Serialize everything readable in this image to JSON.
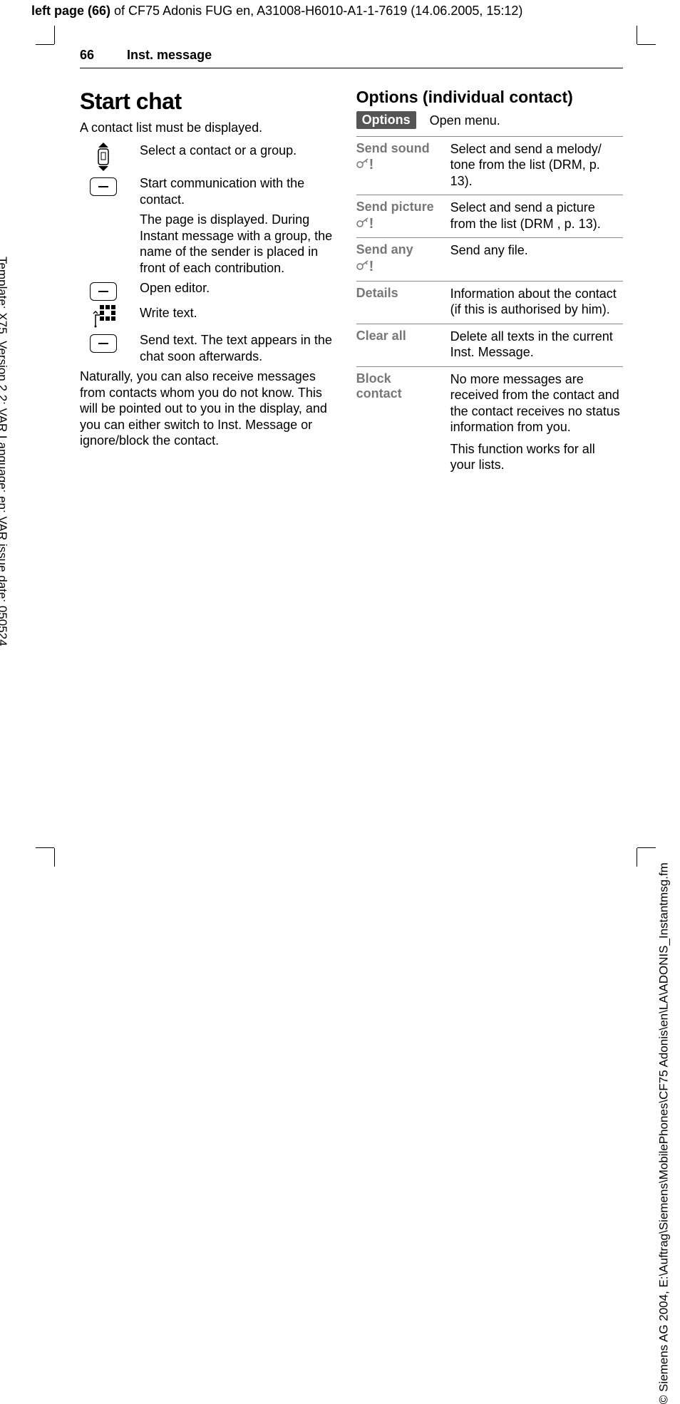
{
  "header": {
    "left_label": "left page (66)",
    "of": " of CF75 Adonis FUG en, A31008-H6010-A1-1-7619 (14.06.2005, 15:12)"
  },
  "side_left": "Template: X75, Version 2.2; VAR Language: en; VAR issue date: 050524",
  "side_right": "© Siemens AG 2004, E:\\Auftrag\\Siemens\\MobilePhones\\CF75 Adonis\\en\\LA\\ADONIS_Instantmsg.fm",
  "runhead": {
    "page": "66",
    "section": "Inst. message"
  },
  "left": {
    "title": "Start chat",
    "intro": "A contact list must be displayed.",
    "steps": [
      {
        "icon": "scroll-icon",
        "text": "Select a contact or a group."
      },
      {
        "icon": "softkey-icon",
        "text": "Start communication with the contact."
      },
      {
        "icon": "",
        "text": "The page is displayed. During Instant message with a group, the name of the sender is placed in front of each contribution."
      },
      {
        "icon": "softkey-icon",
        "text": "Open editor."
      },
      {
        "icon": "keypad-icon",
        "text": "Write text."
      },
      {
        "icon": "softkey-icon",
        "text": "Send text. The text appears in the chat soon afterwards."
      }
    ],
    "footer": "Naturally, you can also receive messages from contacts whom you do not know. This will be pointed out to you in the display, and you can either switch to Inst. Message or ignore/block the contact."
  },
  "right": {
    "heading": "Options (individual contact)",
    "options_label": "Options",
    "open_menu": "Open menu.",
    "rows": [
      {
        "name": "Send sound",
        "drm": true,
        "drm_below": true,
        "desc": "Select and send a melody/ tone from the list (DRM, p. 13)."
      },
      {
        "name": "Send picture",
        "drm": true,
        "drm_below": false,
        "desc": "Select and send a picture from the list (DRM , p. 13)."
      },
      {
        "name": "Send any",
        "drm": true,
        "drm_below": true,
        "desc": "Send any file."
      },
      {
        "name": "Details",
        "drm": false,
        "desc": "Information about the contact (if this is authorised by him)."
      },
      {
        "name": "Clear all",
        "drm": false,
        "desc": "Delete all texts in the current Inst. Message."
      },
      {
        "name": "Block contact",
        "drm": false,
        "desc": "No more messages are received from the contact and the contact receives no status information from you.",
        "extra": "This function works for all your lists."
      }
    ]
  }
}
